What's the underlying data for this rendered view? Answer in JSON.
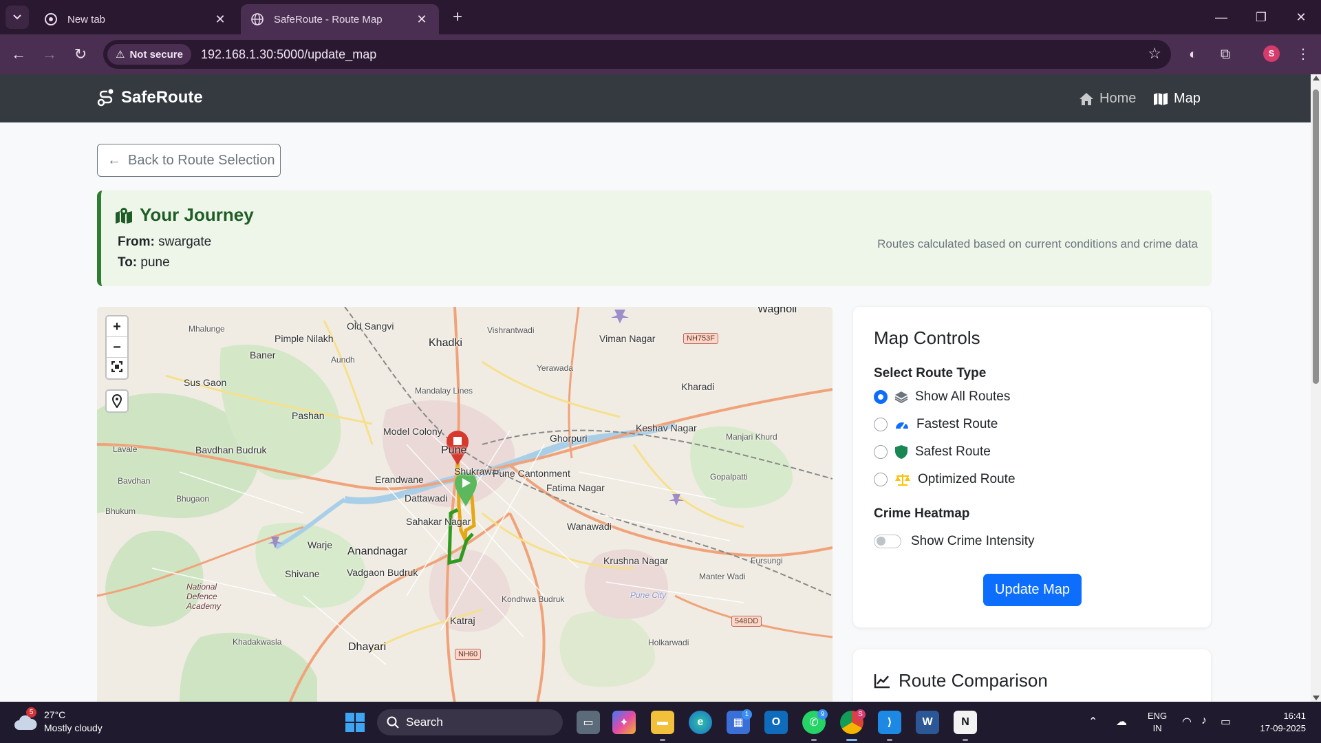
{
  "browser": {
    "tabs": [
      {
        "title": "New tab",
        "active": false
      },
      {
        "title": "SafeRoute - Route Map",
        "active": true
      }
    ],
    "security_label": "Not secure",
    "url": "192.168.1.30:5000/update_map",
    "profile_initial": "S"
  },
  "navbar": {
    "brand": "SafeRoute",
    "links": [
      {
        "label": "Home",
        "icon": "home-icon",
        "active": false
      },
      {
        "label": "Map",
        "icon": "map-icon",
        "active": true
      }
    ]
  },
  "back_button": {
    "label": "Back to Route Selection"
  },
  "journey": {
    "title": "Your Journey",
    "from_label": "From:",
    "from_value": "swargate",
    "to_label": "To:",
    "to_value": "pune",
    "note": "Routes calculated based on current conditions and crime data"
  },
  "map": {
    "zoom_in": "+",
    "zoom_out": "−",
    "place_labels": [
      "Wagholi",
      "Old Sangvi",
      "Mhalunge",
      "Pimple Nilakh",
      "Khadki",
      "Vishrantwadi",
      "Viman Nagar",
      "NH753F",
      "Baner",
      "Aundh",
      "Yerawada",
      "Sus Gaon",
      "Mandalay Lines",
      "Kharadi",
      "Pashan",
      "Model Colony",
      "Keshav Nagar",
      "Lavale",
      "Bavdhan Budruk",
      "Pune",
      "Ghorpuri",
      "Manjari Khurd",
      "Shukrawar",
      "Pune Cantonment",
      "Bavdhan",
      "Erandwane",
      "Fatima Nagar",
      "Gopalpatti",
      "Bhugaon",
      "Dattawadi",
      "Bhukum",
      "Sahakar Nagar",
      "Wanawadi",
      "Warje",
      "Anandnagar",
      "Shivane",
      "Vadgaon Budruk",
      "Krushna Nagar",
      "Fursungi",
      "National Defence Academy",
      "Kondhwa Budruk",
      "Manter Wadi",
      "Katraj",
      "548DD",
      "Khadakwasla",
      "Dhayari",
      "NH60",
      "Holkarwadi",
      "Pune City"
    ]
  },
  "controls": {
    "title": "Map Controls",
    "route_type_heading": "Select Route Type",
    "route_options": [
      {
        "label": "Show All Routes",
        "icon": "layers-icon",
        "icon_color": "#6c757d",
        "checked": true
      },
      {
        "label": "Fastest Route",
        "icon": "speedometer-icon",
        "icon_color": "#0d6efd",
        "checked": false
      },
      {
        "label": "Safest Route",
        "icon": "shield-icon",
        "icon_color": "#198754",
        "checked": false
      },
      {
        "label": "Optimized Route",
        "icon": "balance-scale-icon",
        "icon_color": "#ffc107",
        "checked": false
      }
    ],
    "heatmap_heading": "Crime Heatmap",
    "heatmap_toggle_label": "Show Crime Intensity",
    "heatmap_enabled": false,
    "update_button": "Update Map"
  },
  "comparison": {
    "title": "Route Comparison"
  },
  "taskbar": {
    "weather_temp": "27°C",
    "weather_desc": "Mostly cloudy",
    "weather_badge": "5",
    "search_placeholder": "Search",
    "badges": {
      "store": "1",
      "whatsapp": "9",
      "chrome": "S"
    },
    "lang_line1": "ENG",
    "lang_line2": "IN",
    "time": "16:41",
    "date": "17-09-2025"
  },
  "colors": {
    "navbar_bg": "#343a40",
    "primary": "#0d6efd",
    "journey_accent": "#2e7d32",
    "route_green": "#2e9b1e",
    "route_yellow": "#e5a712",
    "marker_red": "#d63a2f"
  }
}
